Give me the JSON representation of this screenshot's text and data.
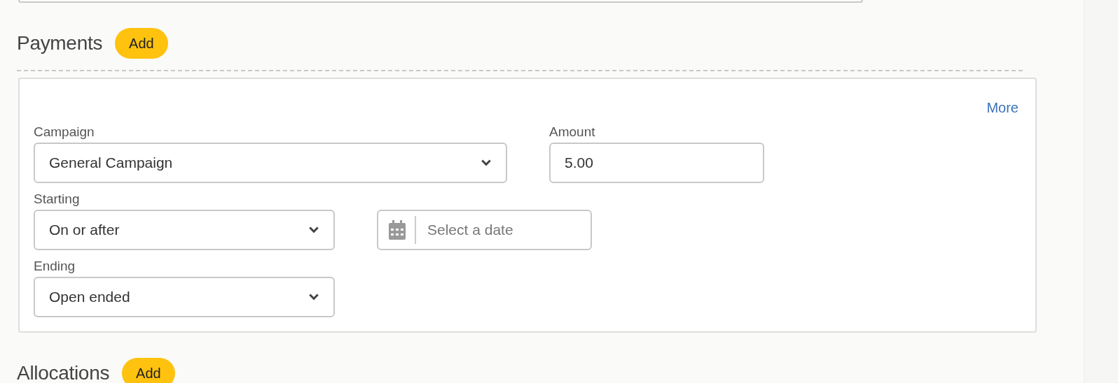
{
  "sections": [
    {
      "title": "Payments",
      "add_button": "Add",
      "card": {
        "more_link": "More",
        "rows": [
          [
            {
              "kind": "select",
              "label": "Campaign",
              "value": "General Campaign"
            },
            {
              "kind": "text",
              "label": "Amount",
              "value": "5.00"
            }
          ],
          [
            {
              "kind": "select",
              "label": "Starting",
              "value": "On or after"
            },
            {
              "kind": "date",
              "placeholder": "Select a date"
            }
          ],
          [
            {
              "kind": "select",
              "label": "Ending",
              "value": "Open ended"
            }
          ]
        ]
      }
    },
    {
      "title": "Allocations",
      "add_button": "Add"
    }
  ]
}
